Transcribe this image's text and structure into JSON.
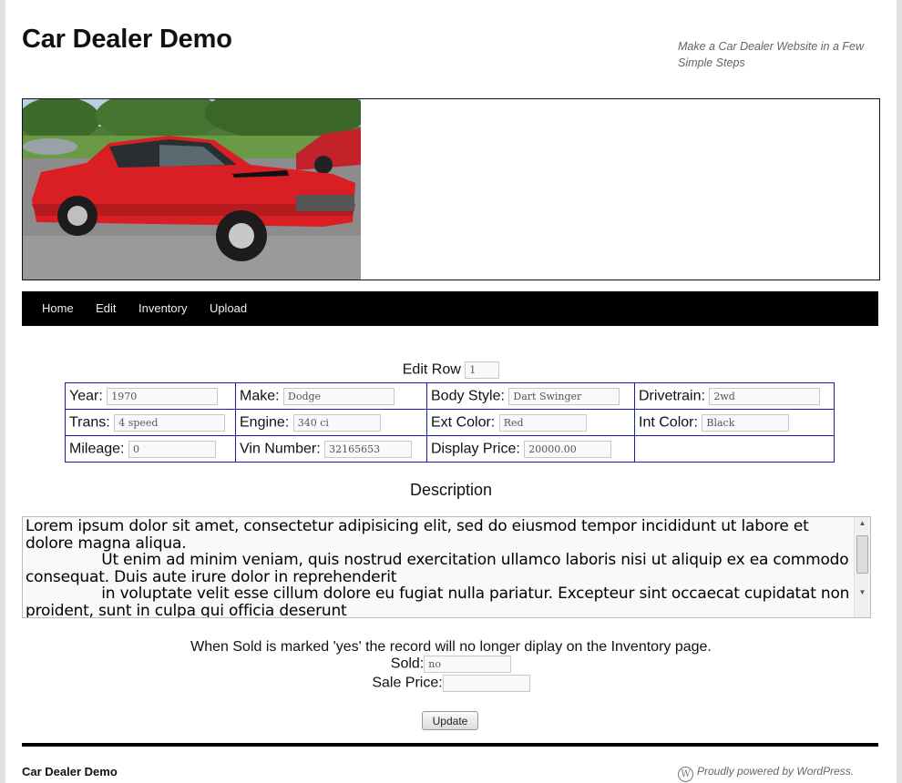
{
  "site": {
    "title": "Car Dealer Demo",
    "description": "Make a Car Dealer Website in a Few Simple Steps"
  },
  "nav": {
    "items": [
      "Home",
      "Edit",
      "Inventory",
      "Upload"
    ]
  },
  "edit_row": {
    "label": "Edit Row",
    "value": "1"
  },
  "fields": {
    "year": {
      "label": "Year:",
      "value": "1970"
    },
    "make": {
      "label": "Make:",
      "value": "Dodge"
    },
    "body_style": {
      "label": "Body Style:",
      "value": "Dart Swinger"
    },
    "drivetrain": {
      "label": "Drivetrain:",
      "value": "2wd"
    },
    "trans": {
      "label": "Trans:",
      "value": "4 speed"
    },
    "engine": {
      "label": "Engine:",
      "value": "340 ci"
    },
    "ext_color": {
      "label": "Ext Color:",
      "value": "Red"
    },
    "int_color": {
      "label": "Int Color:",
      "value": "Black"
    },
    "mileage": {
      "label": "Mileage:",
      "value": "0"
    },
    "vin": {
      "label": "Vin Number:",
      "value": "32165653"
    },
    "display_price": {
      "label": "Display Price:",
      "value": "20000.00"
    }
  },
  "description": {
    "heading": "Description",
    "text": "Lorem ipsum dolor sit amet, consectetur adipisicing elit, sed do eiusmod tempor incididunt ut labore et dolore magna aliqua.\n                Ut enim ad minim veniam, quis nostrud exercitation ullamco laboris nisi ut aliquip ex ea commodo consequat. Duis aute irure dolor in reprehenderit\n                in voluptate velit esse cillum dolore eu fugiat nulla pariatur. Excepteur sint occaecat cupidatat non proident, sunt in culpa qui officia deserunt"
  },
  "sold": {
    "note": "When Sold is marked 'yes' the record will no longer diplay on the Inventory page.",
    "sold_label": "Sold:",
    "sold_value": "no",
    "price_label": "Sale Price:",
    "price_value": ""
  },
  "update_button": "Update",
  "footer": {
    "title": "Car Dealer Demo",
    "credit": "Proudly powered by WordPress."
  },
  "colors": {
    "nav_bg": "#000000",
    "table_border": "#1c1ca4",
    "car": "#d91f24"
  },
  "icons": {
    "footer": "wordpress-icon"
  }
}
